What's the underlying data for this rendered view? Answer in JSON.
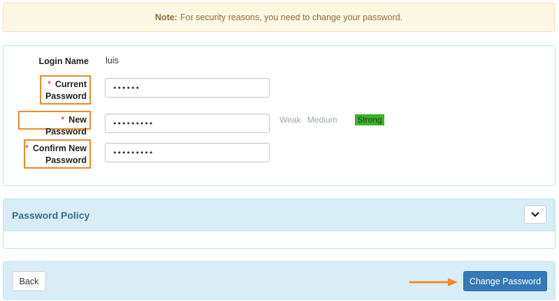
{
  "notice": {
    "prefix": "Note:",
    "text": "For security reasons, you need to change your password."
  },
  "form": {
    "login_name_label": "Login Name",
    "login_name_value": "luis",
    "required_marker": "*",
    "current_password_label_1": "Current",
    "current_password_label_2": "Password",
    "current_password_value": "••••••",
    "new_password_label": "New Password",
    "new_password_value": "•••••••••",
    "confirm_password_label_1": "Confirm New",
    "confirm_password_label_2": "Password",
    "confirm_password_value": "•••••••••",
    "strength": {
      "weak": "Weak",
      "medium": "Medium",
      "strong": "Strong",
      "active": "strong"
    }
  },
  "policy": {
    "title": "Password Policy",
    "toggle_icon": "chevron-down-icon"
  },
  "footer": {
    "back_label": "Back",
    "change_label": "Change Password"
  },
  "colors": {
    "accent_orange": "#f08a24",
    "primary_blue": "#337ab7",
    "strength_strong": "#3cb22e",
    "info_bg": "#d9edf7",
    "warning_bg": "#fcf8e3"
  }
}
